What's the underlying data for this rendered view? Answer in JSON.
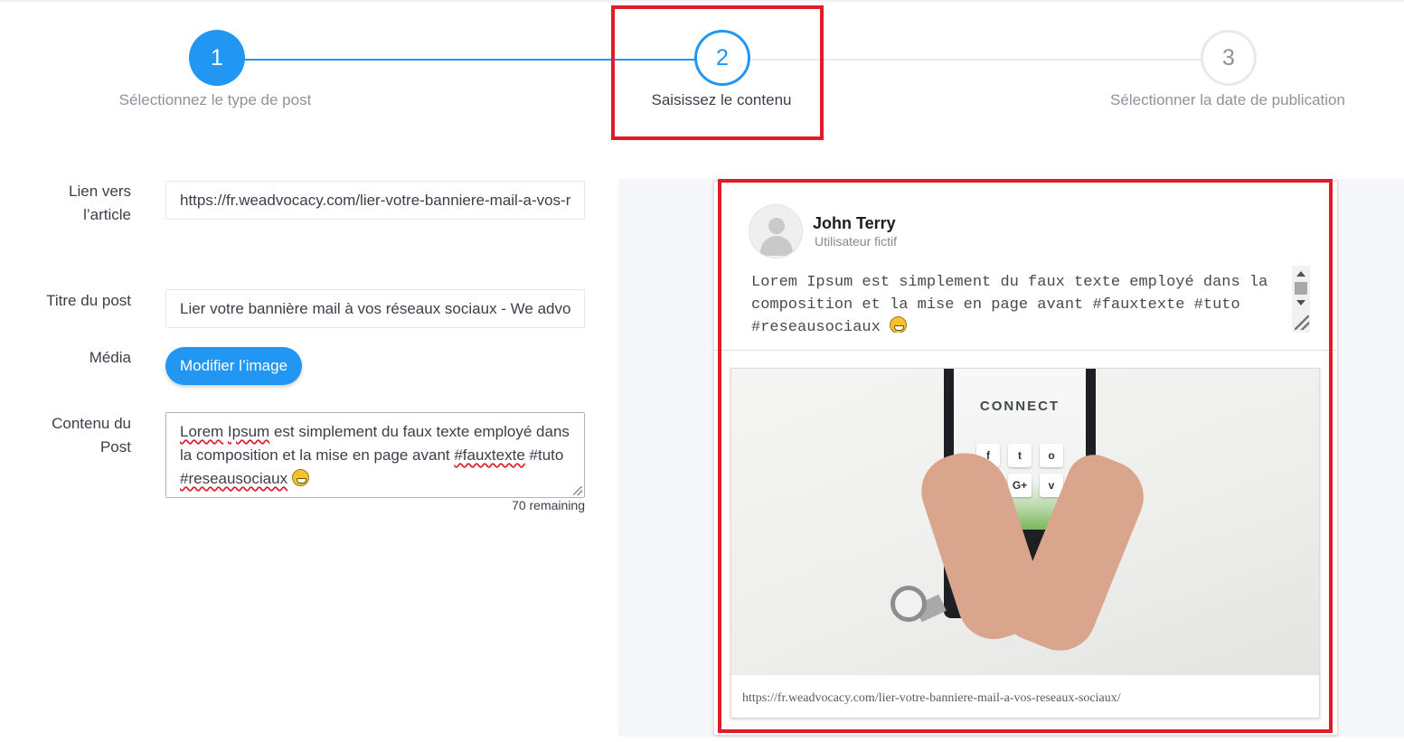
{
  "stepper": {
    "steps": [
      {
        "number": "1",
        "label": "Sélectionnez le type de post",
        "state": "completed"
      },
      {
        "number": "2",
        "label": "Saisissez le contenu",
        "state": "active"
      },
      {
        "number": "3",
        "label": "Sélectionner la date de publication",
        "state": "pending"
      }
    ]
  },
  "form": {
    "link_label": "Lien vers l’article",
    "link_value": "https://fr.weadvocacy.com/lier-votre-banniere-mail-a-vos-reseaux-sociaux/",
    "title_label": "Titre du post",
    "title_value": "Lier votre bannière mail à vos réseaux sociaux - We advocacy",
    "media_label": "Média",
    "media_button": "Modifier l’image",
    "content_label": "Contenu du Post",
    "content": {
      "w1": "Lorem",
      "w2": "Ipsum",
      "rest1": " est simplement du faux texte employé dans la composition et la mise en page avant ",
      "tag1": "#fauxtexte",
      "tag2": " #tuto ",
      "tag3": "#reseausociaux"
    },
    "remaining": "70 remaining"
  },
  "preview": {
    "user_name": "John Terry",
    "user_subtitle": "Utilisateur fictif",
    "post_text": "Lorem Ipsum est simplement du faux texte employé dans la composition et la mise en page avant #fauxtexte #tuto #reseausociaux",
    "image_text": "CONNECT",
    "link_url": "https://fr.weadvocacy.com/lier-votre-banniere-mail-a-vos-reseaux-sociaux/"
  },
  "colors": {
    "accent": "#2196f3",
    "highlight": "#e01b2a"
  }
}
